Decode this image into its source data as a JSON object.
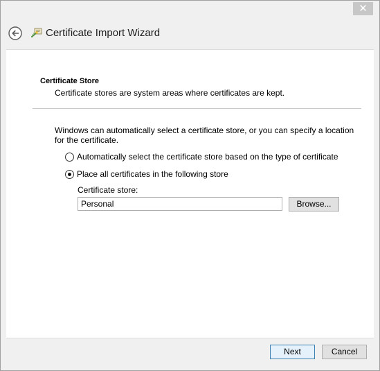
{
  "window": {
    "title": "Certificate Import Wizard",
    "close_glyph": "✕",
    "icons": {
      "back": "back-arrow-icon",
      "wizard": "certificate-wizard-icon",
      "close": "close-icon"
    }
  },
  "page": {
    "section_title": "Certificate Store",
    "section_subtitle": "Certificate stores are system areas where certificates are kept.",
    "description": "Windows can automatically select a certificate store, or you can specify a location for the certificate.",
    "options": [
      {
        "label": "Automatically select the certificate store based on the type of certificate",
        "checked": false
      },
      {
        "label": "Place all certificates in the following store",
        "checked": true
      }
    ],
    "store_label": "Certificate store:",
    "store_value": "Personal",
    "browse_label": "Browse..."
  },
  "footer": {
    "next_label": "Next",
    "cancel_label": "Cancel"
  }
}
